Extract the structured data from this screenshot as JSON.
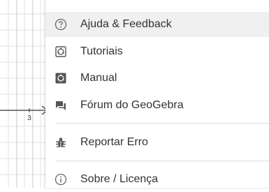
{
  "graph": {
    "axis_tick_label": "3"
  },
  "menu": {
    "items": [
      {
        "label": "Ajuda & Feedback",
        "icon": "help-circle-icon"
      },
      {
        "label": "Tutoriais",
        "icon": "tutorials-icon"
      },
      {
        "label": "Manual",
        "icon": "manual-icon"
      },
      {
        "label": "Fórum do GeoGebra",
        "icon": "forum-icon"
      },
      {
        "label": "Reportar Erro",
        "icon": "bug-icon"
      },
      {
        "label": "Sobre / Licença",
        "icon": "info-icon"
      }
    ],
    "colors": {
      "highlight_bg": "#f0f0f0",
      "text": "#333333",
      "icon": "#555555",
      "grid": "#d8d8d8"
    }
  }
}
